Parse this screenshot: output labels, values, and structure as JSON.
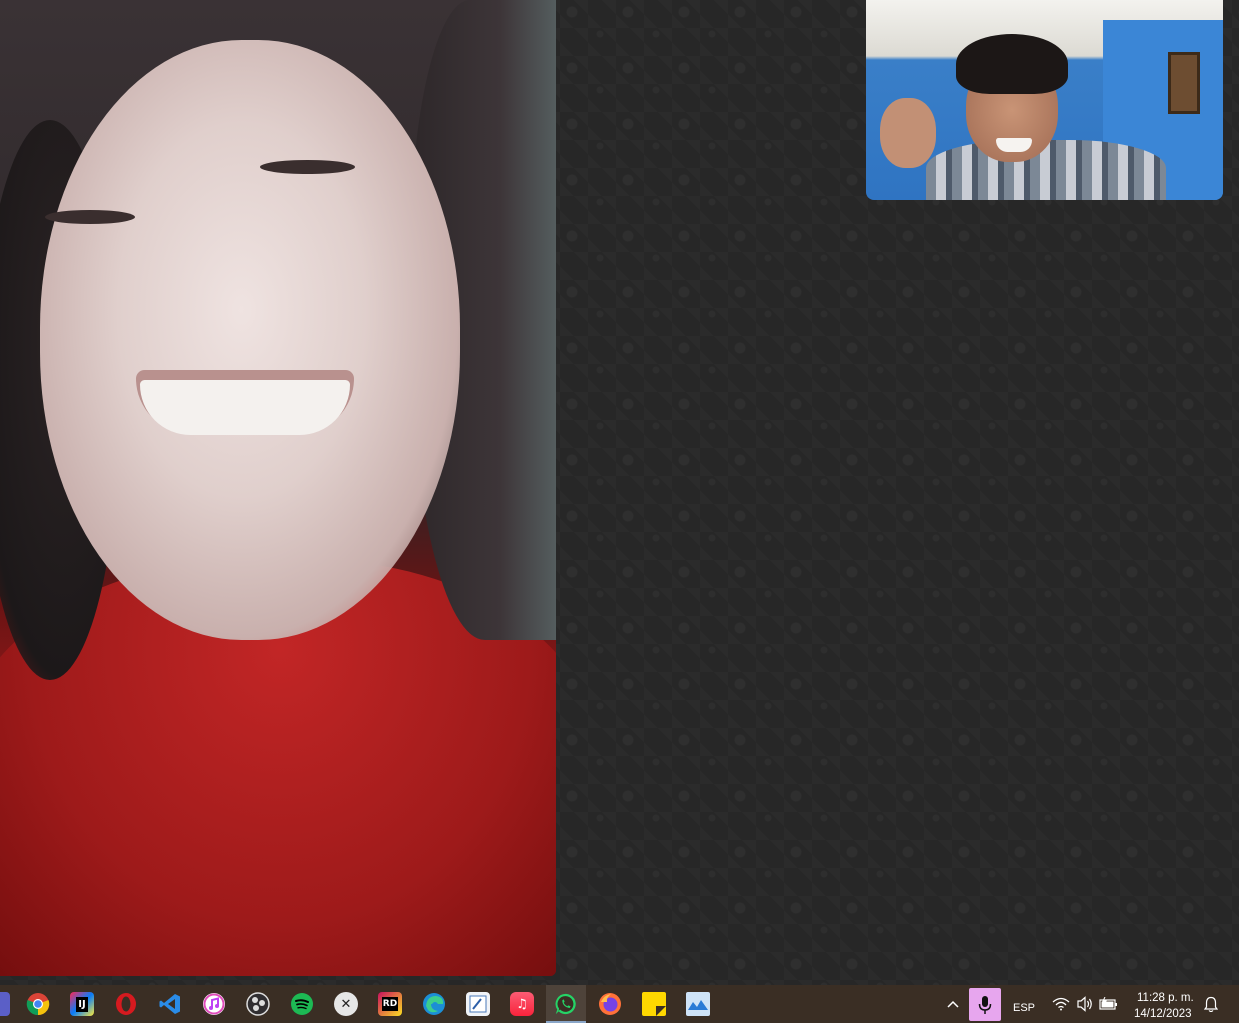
{
  "call": {
    "remote_participant": "remote-video",
    "self_participant": "self-view"
  },
  "taskbar": {
    "apps": [
      {
        "name": "teams-icon",
        "label": ""
      },
      {
        "name": "chrome-icon",
        "label": ""
      },
      {
        "name": "intellij-icon",
        "label": "IJ"
      },
      {
        "name": "opera-icon",
        "label": "O"
      },
      {
        "name": "vscode-icon",
        "label": "⟨⟩"
      },
      {
        "name": "itunes-icon",
        "label": "♪"
      },
      {
        "name": "obs-icon",
        "label": ""
      },
      {
        "name": "spotify-icon",
        "label": ""
      },
      {
        "name": "app-x-icon",
        "label": "✕"
      },
      {
        "name": "rider-icon",
        "label": "RD"
      },
      {
        "name": "edge-icon",
        "label": ""
      },
      {
        "name": "paint-icon",
        "label": ""
      },
      {
        "name": "apple-music-icon",
        "label": "♫"
      },
      {
        "name": "whatsapp-icon",
        "label": "☎"
      },
      {
        "name": "firefox-icon",
        "label": ""
      },
      {
        "name": "sticky-notes-icon",
        "label": ""
      },
      {
        "name": "photos-icon",
        "label": ""
      }
    ],
    "active_app": "whatsapp-icon",
    "tray": {
      "language": "ESP",
      "time": "11:28 p. m.",
      "date": "14/12/2023"
    }
  },
  "colors": {
    "taskbar_bg": "#3a2e24",
    "call_bg": "#272727",
    "mic_active": "#e7a6ee",
    "whatsapp_green": "#25d366",
    "spotify_green": "#1db954",
    "opera_red": "#d61a1f",
    "vscode_blue": "#2a8ce8"
  }
}
